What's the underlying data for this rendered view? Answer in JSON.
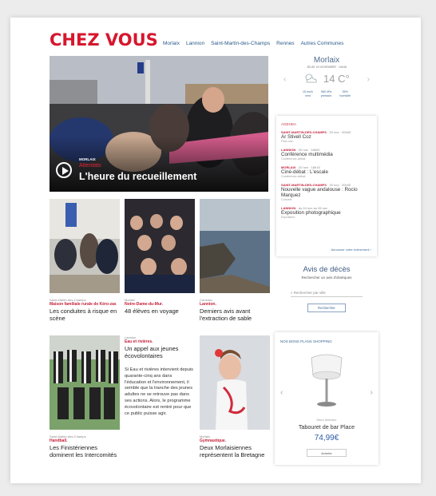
{
  "site": {
    "logo": "CHEZ VOUS"
  },
  "nav": [
    "Morlaix",
    "Lannion",
    "Saint-Martin-des-Champs",
    "Rennes",
    "Autres Communes"
  ],
  "hero": {
    "city": "Morlaix",
    "kicker": "Attentats",
    "title": "L'heure du recueillement"
  },
  "weather": {
    "city": "Morlaix",
    "date": "JEUDI 19 NOVEMBRE · 14h36",
    "temp": "14 C°",
    "details": [
      {
        "value": "15 km/h",
        "label": "vent"
      },
      {
        "value": "980 hPa",
        "label": "pression"
      },
      {
        "value": "55%",
        "label": "humidité"
      }
    ]
  },
  "agenda": {
    "title": "Agenda",
    "items": [
      {
        "city": "SAINT-MARTIN-DES-CHAMPS",
        "meta": " · 20 nov · 20h00",
        "name": "Ar Stivell Coz",
        "type": "Fest-noz"
      },
      {
        "city": "LANNION",
        "meta": " · 20 nov · 18h00",
        "name": "Conférence multimédia",
        "type": "Conférence-débat"
      },
      {
        "city": "MORLAIX",
        "meta": " · 20 nov · 18h15",
        "name": "Ciné-débat : L'escale",
        "type": "Conférence-débat"
      },
      {
        "city": "SAINT-MARTIN-DES-CHAMPS",
        "meta": " · 20 nov · 20h30",
        "name": "Nouvelle vague andalouse : Rocio Marquez",
        "type": "Concert"
      },
      {
        "city": "LANNION",
        "meta": " · du 10 nov au 28 nov",
        "name": "Exposition photographique",
        "type": "Exposition"
      }
    ],
    "link": "Annoncer votre événement ›"
  },
  "deces": {
    "title": "Avis de décès",
    "subtitle": "Rechercher un avis d'obsèques",
    "placeholder": "Rechercher par ville",
    "button": "Rechercher"
  },
  "shop": {
    "title": "Nos bons plans shopping",
    "brand": "Déco Intérieur",
    "name": "Tabouret de bar Place",
    "price": "74,99€",
    "button": "Acheter"
  },
  "cards": [
    {
      "city": "Saint-Martin-des-Champs",
      "kicker": "Maison familiale rurale de Kéro-zas",
      "title": "Les conduites à risque en scène"
    },
    {
      "city": "Morlaix",
      "kicker": "Notre-Dame-du-Mur.",
      "title": "48 élèves en voyage"
    },
    {
      "city": "Carantec",
      "kicker": "Lannion.",
      "title": "Derniers avis avant l'extraction de sable"
    },
    {
      "city": "Saint-Martin-des-Champs",
      "kicker": "Handball.",
      "title": "Les Finistériennes dominent les Intercomités"
    },
    {
      "city": "Lannion",
      "kicker": "Eau et rivières.",
      "title": "Un appel aux jeunes écovolontaires",
      "body": "Si Eau et rivières intervient depuis quarante-cinq ans dans l'éducation et l'environnement, il semble que la tranche des jeunes adultes ne se retrouve pas dans ses actions. Alors, le programme écovolontaire est rentré pour que ce public puisse agir."
    },
    {
      "city": "Morlaix",
      "kicker": "Gymnastique.",
      "title": "Deux Morlaisiennes représentent la Bretagne"
    }
  ]
}
